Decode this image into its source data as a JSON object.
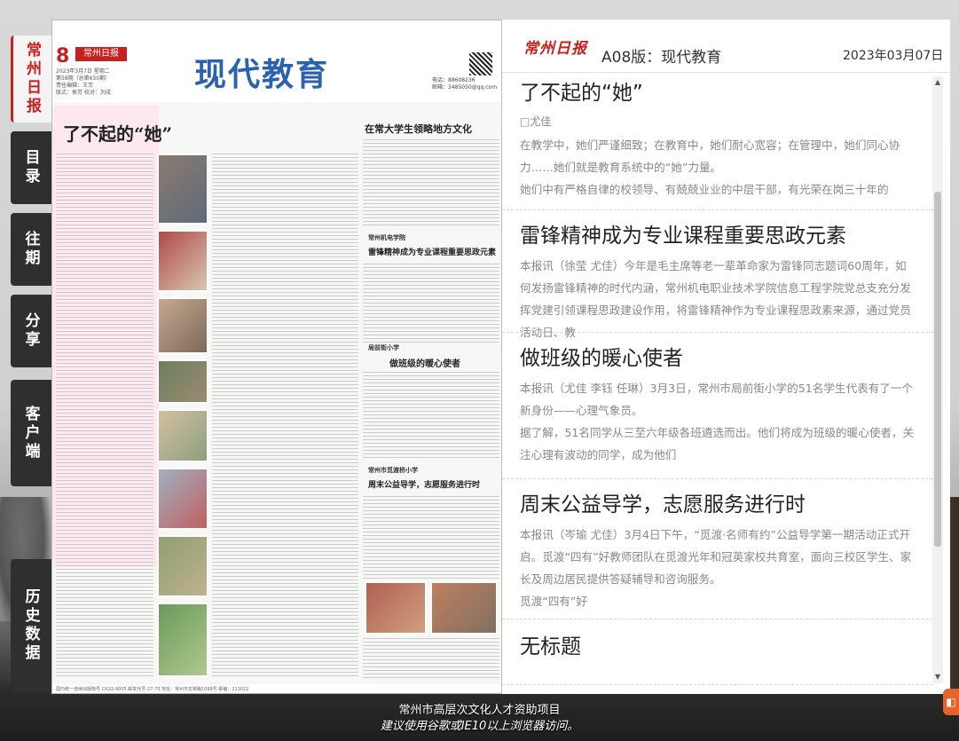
{
  "nav": {
    "tabs": [
      {
        "label": "常州日报",
        "active": true
      },
      {
        "label": "目录"
      },
      {
        "label": "往期"
      },
      {
        "label": "分享"
      },
      {
        "label": "客户端"
      },
      {
        "label": "历史数据"
      }
    ]
  },
  "paper": {
    "page_number": "8",
    "logo_text": "常州日报",
    "title": "现代教育",
    "meta": "2023年3月7日 星期二\n第58期（总第650期）\n责任编辑：王芳\n版式：侯芳 校对：刘成",
    "contact": "电话：88608236\n邮箱：3485050@qq.com",
    "headline_main": "了不起的“她”",
    "headline_right": "在常大学生领略地方文化",
    "headline_mid1": "雷锋精神成为专业课程重要思政元素",
    "headline_mid2": "做班级的暖心使者",
    "headline_mid3": "周末公益导学，志愿服务进行时",
    "section_label1": "常州机电学院",
    "section_label2": "局前街小学",
    "section_label3": "常州市觅渡桥小学",
    "footer_text": "国内统一连续出版物号 CN32-0005 邮发代号 27-70 地址：常州市龙锦路1099号 邮编：213022"
  },
  "panel": {
    "brand": "常州日报",
    "edition": "A08版：现代教育",
    "date": "2023年03月07日"
  },
  "articles": [
    {
      "title": "了不起的“她”",
      "byline": "□尤佳",
      "body": "在教学中，她们严谨细致；在教育中，她们耐心宽容；在管理中，她们同心协力……她们就是教育系统中的“她”力量。",
      "body2": "她们中有严格自律的校领导、有兢兢业业的中层干部，有光荣在岗三十年的"
    },
    {
      "title": "雷锋精神成为专业课程重要思政元素",
      "byline": "",
      "body": "本报讯（徐莹 尤佳）今年是毛主席等老一辈革命家为雷锋同志题词60周年，如何发扬雷锋精神的时代内涵，常州机电职业技术学院信息工程学院党总支充分发挥党建引领课程思政建设作用，将雷锋精神作为专业课程思政素来源，通过党员活动日、教",
      "body2": ""
    },
    {
      "title": "做班级的暖心使者",
      "byline": "",
      "body": "本报讯（尤佳 李钰 任琳）3月3日，常州市局前街小学的51名学生代表有了一个新身份——心理气象员。",
      "body2": "据了解，51名同学从三至六年级各班遴选而出。他们将成为班级的暖心使者，关注心理有波动的同学，成为他们"
    },
    {
      "title": "周末公益导学，志愿服务进行时",
      "byline": "",
      "body": "本报讯（岑瑜 尤佳）3月4日下午，“觅渡·名师有约”公益导学第一期活动正式开启。觅渡“四有”好教师团队在觅渡光年和冠英家校共育室，面向三校区学生、家长及周边居民提供答疑辅导和咨询服务。",
      "body2": "觅渡“四有”好"
    },
    {
      "title": "无标题",
      "byline": "",
      "body": "",
      "body2": ""
    }
  ],
  "footer": {
    "line1": "常州市高层次文化人才资助项目",
    "line2": "建议使用谷歌或IE10以上浏览器访问。"
  },
  "colors": {
    "brand_red": "#c81f1f",
    "title_blue": "#2a62b0",
    "tab_dark": "#2f2f2f"
  }
}
